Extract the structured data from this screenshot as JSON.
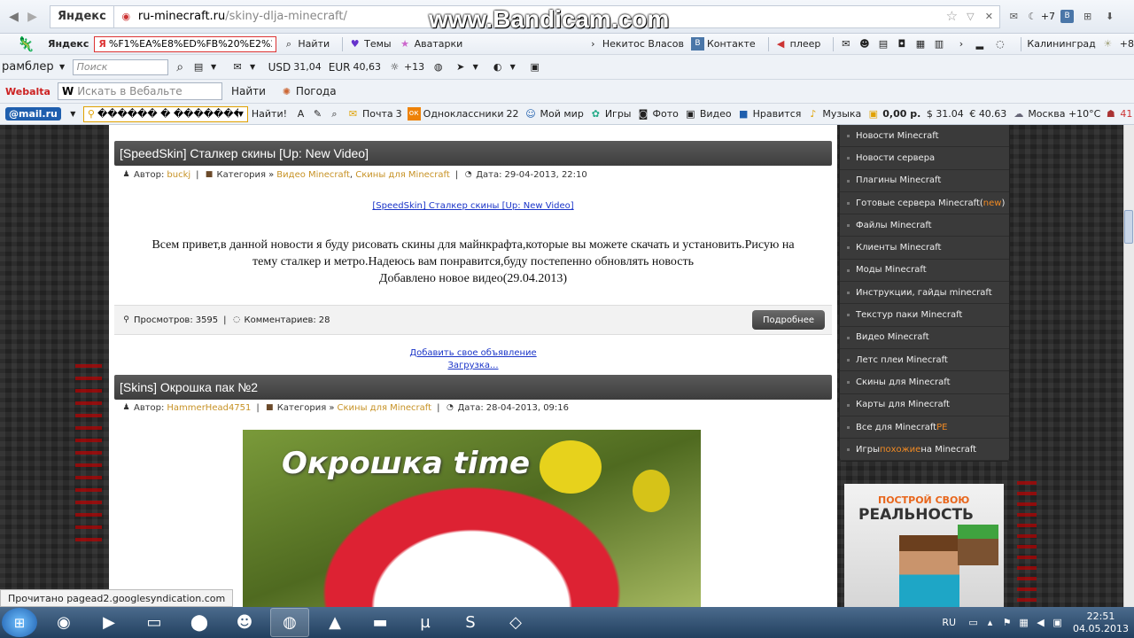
{
  "browser": {
    "yandex_logo": "Яндекс",
    "url_domain": "ru-minecraft.ru",
    "url_path": "/skiny-dlja-minecraft/",
    "tab_count": "+7",
    "watermark": "www.Bandicam.com"
  },
  "yandex_bar": {
    "brand": "Яндекс",
    "search_value": "%F1%EA%E8%ED%FB%20%E2%20%",
    "find_label": "Найти",
    "themes_label": "Темы",
    "avatars_label": "Аватарки",
    "user_label": "Некитос Власов",
    "vk_label": "Контакте",
    "player_label": "плеер",
    "city_label": "Калининград",
    "more_count": "+8"
  },
  "rambler_bar": {
    "brand": "рамблер",
    "search_placeholder": "Поиск",
    "usd_label": "USD",
    "usd_value": "31,04",
    "eur_label": "EUR",
    "eur_value": "40,63",
    "weather_value": "+13"
  },
  "webalta_bar": {
    "brand": "Webalta",
    "search_placeholder": "Искать в Вебальте",
    "find_label": "Найти",
    "weather_label": "Погода"
  },
  "mail_bar": {
    "brand": "@mail.ru",
    "search_value": "������ � �������",
    "find_label": "Найти!",
    "mail_label": "Почта",
    "mail_count": "3",
    "ok_label": "Одноклассники",
    "ok_count": "22",
    "myworld_label": "Мой мир",
    "games_label": "Игры",
    "photo_label": "Фото",
    "video_label": "Видео",
    "likes_label": "Нравится",
    "music_label": "Музыка",
    "balance": "0,00 р.",
    "usd": "31.04",
    "eur": "40.63",
    "weather": "Москва +10°C",
    "mail_badge": "41"
  },
  "article1": {
    "title": "[SpeedSkin] Сталкер скины [Up: New Video]",
    "author_label": "Автор:",
    "author": "buckj",
    "category_label": "Категория »",
    "cat1": "Видео Minecraft",
    "cat2": "Скины для Minecraft",
    "date_label": "Дата:",
    "date": "29-04-2013, 22:10",
    "link": "[SpeedSkin] Сталкер скины [Up: New Video]",
    "line1": "Всем привет,в данной новости я буду рисовать скины для майнкрафта,которые вы можете скачать и установить.Рисую на",
    "line2": "тему сталкер и метро.Надеюсь вам понравится,буду постепенно обновлять новость",
    "line3": "Добавлено новое видео(29.04.2013)",
    "views_label": "Просмотров:",
    "views": "3595",
    "comments_label": "Комментариев:",
    "comments": "28",
    "more": "Подробнее"
  },
  "ad": {
    "add_link": "Добавить свое объявление",
    "loading": "Загрузка..."
  },
  "article2": {
    "title": "[Skins] Окрошка пак №2",
    "author_label": "Автор:",
    "author": "HammerHead4751",
    "category_label": "Категория »",
    "cat1": "Скины для Minecraft",
    "date_label": "Дата:",
    "date": "28-04-2013, 09:16",
    "image_caption": "Окрошка time"
  },
  "sidebar": {
    "items": [
      {
        "label": "Новости Minecraft"
      },
      {
        "label": "Новости сервера"
      },
      {
        "label": "Плагины Minecraft"
      },
      {
        "label": "Готовые сервера Minecraft(",
        "hl": "new",
        "after": ")"
      },
      {
        "label": "Файлы Minecraft"
      },
      {
        "label": "Клиенты Minecraft"
      },
      {
        "label": "Моды Minecraft"
      },
      {
        "label": "Инструкции, гайды minecraft"
      },
      {
        "label": "Текстур паки Minecraft"
      },
      {
        "label": "Видео Minecraft"
      },
      {
        "label": "Летс плеи Minecraft"
      },
      {
        "label": "Скины для Minecraft"
      },
      {
        "label": "Карты для Minecraft"
      },
      {
        "label": "Все для Minecraft ",
        "hl": "PE"
      },
      {
        "label": "Игры ",
        "hl": "похожие",
        "after": " на Minecraft"
      }
    ]
  },
  "banner": {
    "line1": "ПОСТРОЙ СВОЮ",
    "line2": "РЕАЛЬНОСТЬ"
  },
  "status_text": "Прочитано pagead2.googlesyndication.com",
  "taskbar": {
    "lang": "RU",
    "time": "22:51",
    "date": "04.05.2013"
  },
  "colors": {
    "title_bar": "#3d3d3d",
    "link_orange": "#c79225",
    "sidebar_bg": "#3a3a3a",
    "highlight": "#f08a24"
  }
}
